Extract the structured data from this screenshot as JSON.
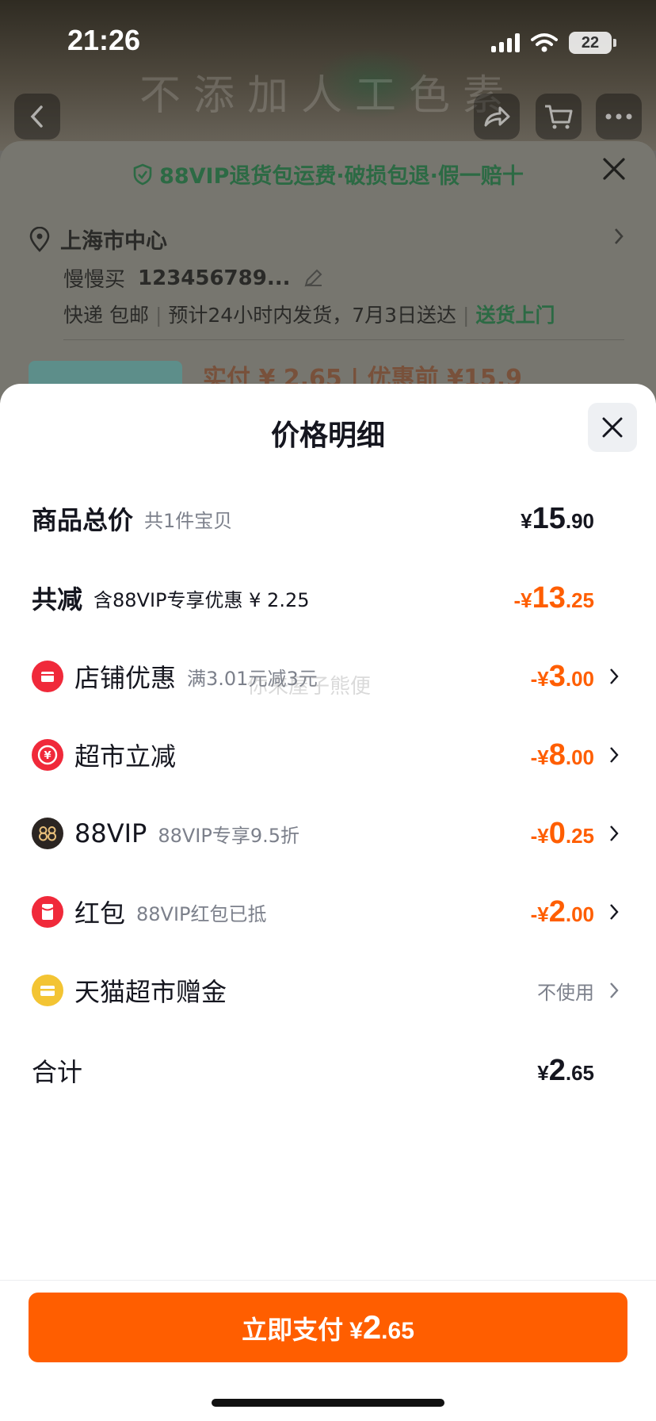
{
  "status_bar": {
    "time": "21:26",
    "battery": "22"
  },
  "background": {
    "banner_text": "不添加人工色素",
    "promo": "88VIP退货包运费·破损包退·假一赔十",
    "address": {
      "location": "上海市中心",
      "recipient": "慢慢买",
      "phone": "123456789...",
      "ship_method": "快递 包邮",
      "ship_eta": "预计24小时内发货，7月3日送达",
      "ship_tag": "送货上门"
    },
    "price_peek": "实付 ¥ 2.65 | 优惠前 ¥15.9"
  },
  "sheet": {
    "title": "价格明细",
    "rows": {
      "total": {
        "label": "商品总价",
        "sub": "共1件宝贝",
        "yen": "¥",
        "big": "15",
        "small": ".90"
      },
      "reduce": {
        "label": "共减",
        "sub": "含88VIP专享优惠 ¥ 2.25",
        "yen": "-¥",
        "big": "13",
        "small": ".25"
      },
      "shop": {
        "label": "店铺优惠",
        "sub": "满3.01元减3元",
        "yen": "-¥",
        "big": "3",
        "small": ".00"
      },
      "market": {
        "label": "超市立减",
        "sub": "",
        "yen": "-¥",
        "big": "8",
        "small": ".00"
      },
      "vip": {
        "label": "88VIP",
        "sub": "88VIP专享9.5折",
        "yen": "-¥",
        "big": "0",
        "small": ".25"
      },
      "redpacket": {
        "label": "红包",
        "sub": "88VIP红包已抵",
        "yen": "-¥",
        "big": "2",
        "small": ".00"
      },
      "gift": {
        "label": "天猫超市赠金",
        "status": "不使用"
      },
      "sum": {
        "label": "合计",
        "yen": "¥",
        "big": "2",
        "small": ".65"
      }
    },
    "watermark": "你来屋子熊便",
    "pay_button": {
      "label": "立即支付",
      "yen": "¥",
      "big": "2",
      "small": ".65"
    }
  },
  "colors": {
    "accent": "#ff5e00",
    "text": "#15161f",
    "muted": "#7c808b",
    "icon_red": "#f0293a",
    "icon_gold": "#f3c433"
  }
}
